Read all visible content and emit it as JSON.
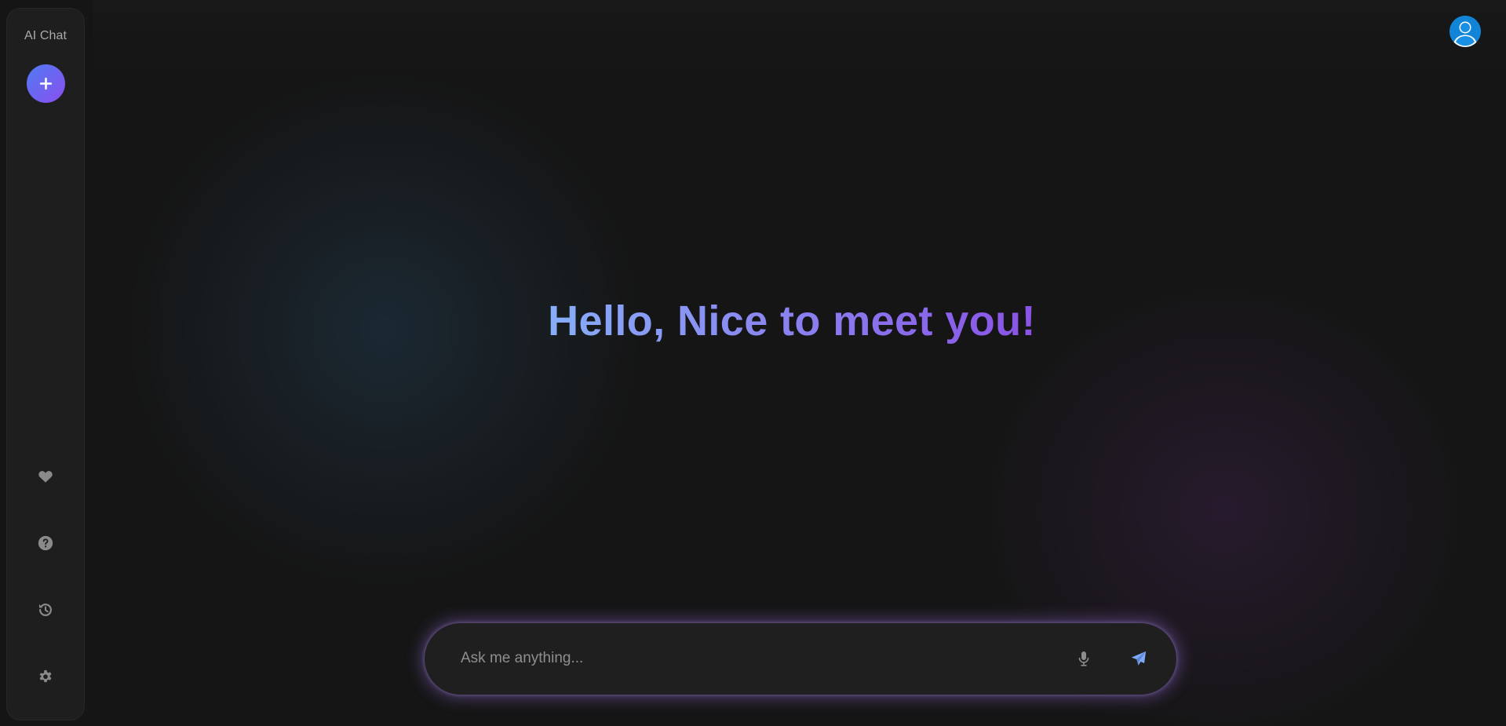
{
  "app": {
    "brand": "AI Chat"
  },
  "sidebar": {
    "new_chat_icon": "plus-icon",
    "items": [
      {
        "id": "favorites",
        "icon": "heart-icon"
      },
      {
        "id": "help",
        "icon": "question-circle-icon"
      },
      {
        "id": "history",
        "icon": "history-icon"
      },
      {
        "id": "settings",
        "icon": "gear-icon"
      }
    ]
  },
  "header": {
    "avatar_icon": "user-avatar-icon"
  },
  "main": {
    "greeting": "Hello, Nice to meet you!"
  },
  "composer": {
    "placeholder": "Ask me anything...",
    "value": "",
    "mic_icon": "microphone-icon",
    "send_icon": "send-icon"
  },
  "colors": {
    "background": "#151515",
    "sidebar": "#1e1e1e",
    "accent_start": "#4f7bf2",
    "accent_end": "#8b4ef0",
    "send_icon": "#7ea8f7",
    "avatar": "#1a8fe0"
  }
}
